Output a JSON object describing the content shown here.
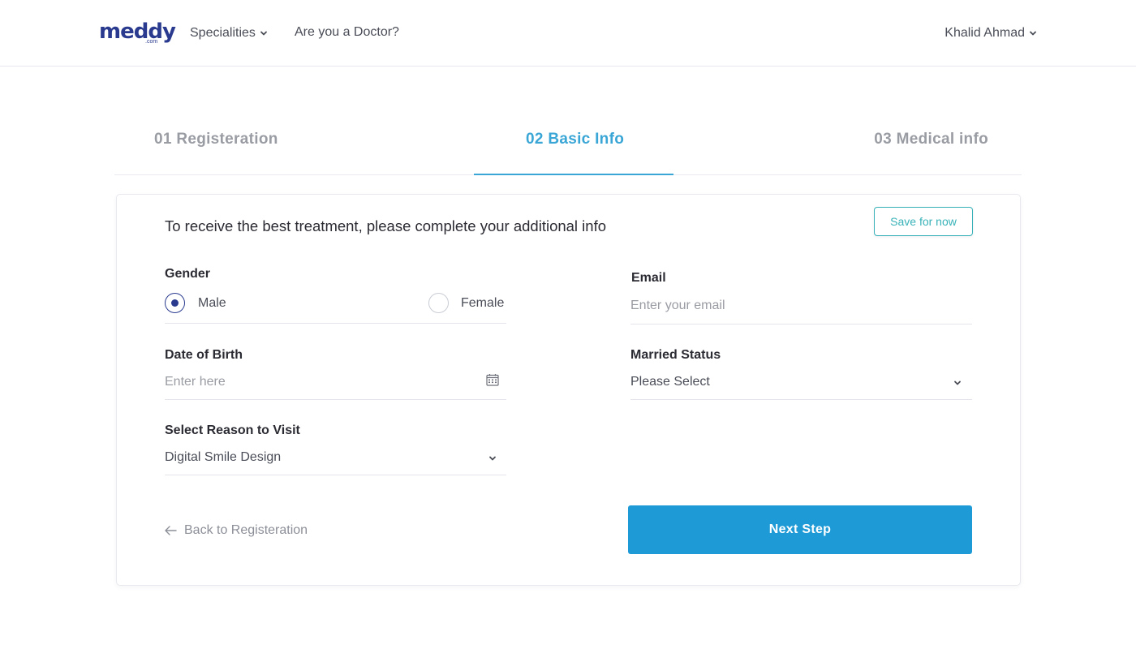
{
  "header": {
    "logo_text": "meddy",
    "logo_sub": ".com",
    "nav": {
      "specialities": "Specialities",
      "doctor": "Are you a Doctor?"
    },
    "user_name": "Khalid Ahmad"
  },
  "steps": [
    {
      "label": "01 Registeration"
    },
    {
      "label": "02 Basic Info"
    },
    {
      "label": "03 Medical info"
    }
  ],
  "form": {
    "intro": "To receive the best treatment, please complete your additional info",
    "save_label": "Save for now",
    "gender": {
      "label": "Gender",
      "options": [
        "Male",
        "Female"
      ],
      "selected": "Male"
    },
    "email": {
      "label": "Email",
      "placeholder": "Enter your email"
    },
    "dob": {
      "label": "Date of Birth",
      "placeholder": "Enter here"
    },
    "married": {
      "label": "Married Status",
      "value": "Please Select"
    },
    "reason": {
      "label": "Select Reason to Visit",
      "value": "Digital Smile Design"
    },
    "back_label": "Back to Registeration",
    "next_label": "Next Step"
  },
  "colors": {
    "brand": "#2a3b8f",
    "accent": "#3aa6d6",
    "primary_button": "#1e9ad6",
    "save_outline": "#38b2b8"
  }
}
